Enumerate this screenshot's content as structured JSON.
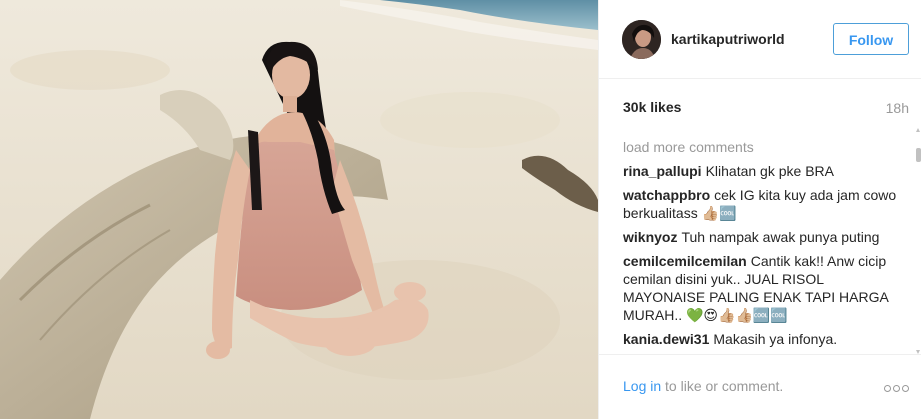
{
  "post": {
    "username": "kartikaputriworld",
    "follow_label": "Follow",
    "likes": "30k likes",
    "time": "18h",
    "load_more": "load more comments",
    "comments": [
      {
        "user": "rina_pallupi",
        "text": "Klihatan gk pke BRA"
      },
      {
        "user": "watchappbro",
        "text": "cek IG kita kuy ada jam cowo berkualitass 👍🏼🆒"
      },
      {
        "user": "wiknyoz",
        "text": "Tuh nampak awak punya puting"
      },
      {
        "user": "cemilcemilcemilan",
        "text": "Cantik kak!! Anw cicip cemilan disini yuk.. JUAL RISOL MAYONAISE PALING ENAK TAPI HARGA MURAH.. 💚😍👍🏼👍🏼🆒🆒"
      },
      {
        "user": "kania.dewi31",
        "text": "Makasih ya infonya."
      }
    ],
    "login_link": "Log in",
    "login_rest": " to like or comment."
  },
  "icons": {
    "more": "more-options-icon",
    "scroll_up": "scroll-up-arrow-icon",
    "scroll_down": "scroll-down-arrow-icon"
  },
  "colors": {
    "accent": "#3897f0",
    "text": "#262626",
    "muted": "#999999",
    "border": "#efefef"
  }
}
